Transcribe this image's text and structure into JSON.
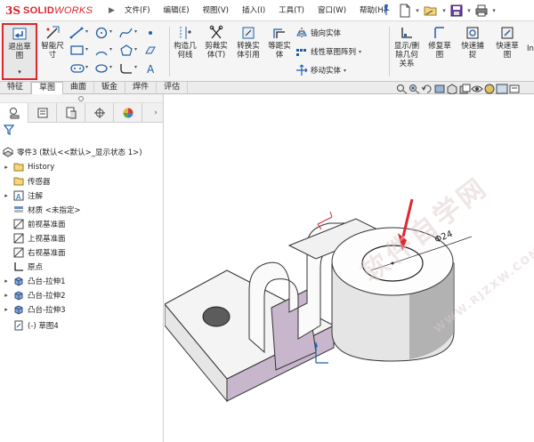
{
  "titlebar": {
    "logo_ds": "3S",
    "logo_solid": "SOLID",
    "logo_works": "WORKS",
    "menu": [
      "文件(F)",
      "编辑(E)",
      "视图(V)",
      "插入(I)",
      "工具(T)",
      "窗口(W)",
      "帮助(H)"
    ]
  },
  "ribbon": {
    "exit_sketch": "退出草\n图",
    "smart_dim": "智能尺\n寸",
    "construct_geom": "构造几\n何线",
    "trim_entities": "剪裁实\n体(T)",
    "convert_entities": "转换实\n体引用",
    "offset_entities": "等距实\n体",
    "mirror_entities": "镜向实体",
    "linear_pattern": "线性草图阵列",
    "move_entities": "移动实体",
    "display_relations": "显示/删\n除几何\n关系",
    "repair_sketch": "修复草\n图",
    "quick_snaps": "快速捕\n捉",
    "rapid_sketch": "快速草\n图",
    "instant2d": "In"
  },
  "tabs": [
    "特征",
    "草图",
    "曲面",
    "钣金",
    "焊件",
    "评估"
  ],
  "active_tab": "草图",
  "tree": {
    "root": "零件3  (默认<<默认>_显示状态 1>)",
    "items": [
      {
        "label": "History",
        "expandable": true,
        "icon": "history-icon"
      },
      {
        "label": "传感器",
        "expandable": false,
        "icon": "sensor-icon"
      },
      {
        "label": "注解",
        "expandable": true,
        "icon": "annotation-icon"
      },
      {
        "label": "材质 <未指定>",
        "expandable": false,
        "icon": "material-icon"
      },
      {
        "label": "前视基准面",
        "expandable": false,
        "icon": "plane-icon"
      },
      {
        "label": "上视基准面",
        "expandable": false,
        "icon": "plane-icon"
      },
      {
        "label": "右视基准面",
        "expandable": false,
        "icon": "plane-icon"
      },
      {
        "label": "原点",
        "expandable": false,
        "icon": "origin-icon"
      },
      {
        "label": "凸台-拉伸1",
        "expandable": true,
        "icon": "extrude-icon"
      },
      {
        "label": "凸台-拉伸2",
        "expandable": true,
        "icon": "extrude-icon"
      },
      {
        "label": "凸台-拉伸3",
        "expandable": true,
        "icon": "extrude-icon"
      },
      {
        "label": "(-) 草图4",
        "expandable": false,
        "icon": "sketch-icon"
      }
    ]
  },
  "dimension": "Φ24",
  "watermark": "软件自学网",
  "watermark_url": "WWW.RJZXW.COM",
  "colors": {
    "brand_red": "#d8232a",
    "highlight_red": "#e0262e",
    "model_face_purple": "#c8b6cc"
  }
}
